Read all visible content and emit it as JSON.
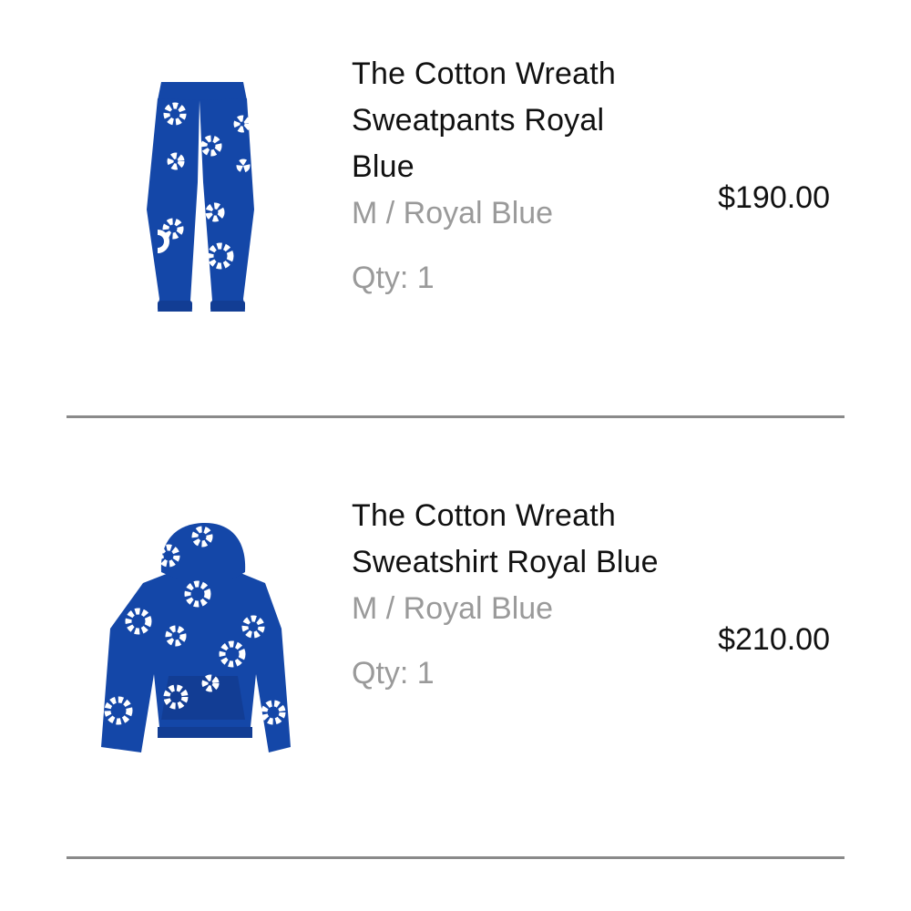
{
  "cart": {
    "items": [
      {
        "title": "The Cotton Wreath Sweatpants Royal Blue",
        "variant": "M / Royal Blue",
        "qty": "Qty: 1",
        "price": "$190.00",
        "image_icon": "sweatpants-product-image"
      },
      {
        "title": "The Cotton Wreath Sweatshirt Royal Blue",
        "variant": "M / Royal Blue",
        "qty": "Qty: 1",
        "price": "$210.00",
        "image_icon": "hoodie-product-image"
      }
    ]
  },
  "colors": {
    "product_blue": "#1447a8",
    "flower_white": "#ffffff",
    "secondary_text": "#9a9a9a",
    "divider": "#8a8a8a"
  }
}
